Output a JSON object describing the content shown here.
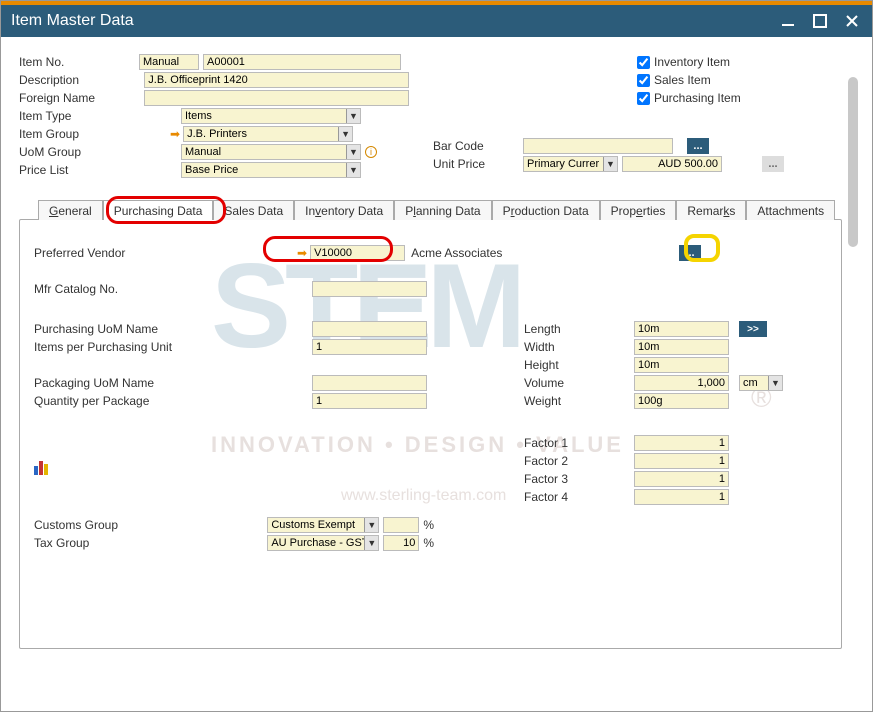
{
  "window": {
    "title": "Item Master Data"
  },
  "header": {
    "item_no_lbl": "Item No.",
    "item_no_mode": "Manual",
    "item_no": "A00001",
    "description_lbl": "Description",
    "description": "J.B. Officeprint 1420",
    "foreign_name_lbl": "Foreign Name",
    "foreign_name": "",
    "item_type_lbl": "Item Type",
    "item_type": "Items",
    "item_group_lbl": "Item Group",
    "item_group": "J.B. Printers",
    "uom_group_lbl": "UoM Group",
    "uom_group": "Manual",
    "price_list_lbl": "Price List",
    "price_list": "Base Price",
    "bar_code_lbl": "Bar Code",
    "bar_code": "",
    "unit_price_lbl": "Unit Price",
    "unit_price_currency": "Primary Currer",
    "unit_price": "AUD 500.00",
    "inventory_item_lbl": "Inventory Item",
    "sales_item_lbl": "Sales Item",
    "purchasing_item_lbl": "Purchasing Item",
    "ellipsis": "..."
  },
  "tabs": {
    "general": "General",
    "purchasing": "Purchasing Data",
    "sales": "Sales Data",
    "inventory": "Inventory Data",
    "planning": "Planning Data",
    "production": "Production Data",
    "properties": "Properties",
    "remarks": "Remarks",
    "attachments": "Attachments"
  },
  "purchasing": {
    "preferred_vendor_lbl": "Preferred Vendor",
    "preferred_vendor": "V10000",
    "preferred_vendor_name": "Acme Associates",
    "mfr_catalog_lbl": "Mfr Catalog No.",
    "mfr_catalog": "",
    "purchasing_uom_lbl": "Purchasing UoM Name",
    "purchasing_uom": "",
    "items_per_unit_lbl": "Items per Purchasing Unit",
    "items_per_unit": "1",
    "packaging_uom_lbl": "Packaging UoM Name",
    "packaging_uom": "",
    "qty_per_pkg_lbl": "Quantity per Package",
    "qty_per_pkg": "1",
    "length_lbl": "Length",
    "length": "10m",
    "width_lbl": "Width",
    "width": "10m",
    "height_lbl": "Height",
    "height": "10m",
    "volume_lbl": "Volume",
    "volume": "1,000",
    "volume_unit": "cm",
    "weight_lbl": "Weight",
    "weight": "100g",
    "factor1_lbl": "Factor 1",
    "factor1": "1",
    "factor2_lbl": "Factor 2",
    "factor2": "1",
    "factor3_lbl": "Factor 3",
    "factor3": "1",
    "factor4_lbl": "Factor 4",
    "factor4": "1",
    "customs_group_lbl": "Customs Group",
    "customs_group": "Customs Exempt",
    "customs_pct": "",
    "pct": "%",
    "tax_group_lbl": "Tax Group",
    "tax_group": "AU Purchase - GST",
    "tax_pct": "10",
    "double_chevron": ">>",
    "ellipsis": "..."
  },
  "watermark": {
    "logo": "STEM",
    "tag": "INNOVATION   •   DESIGN   •   VALUE",
    "url": "www.sterling-team.com",
    "reg": "®"
  }
}
